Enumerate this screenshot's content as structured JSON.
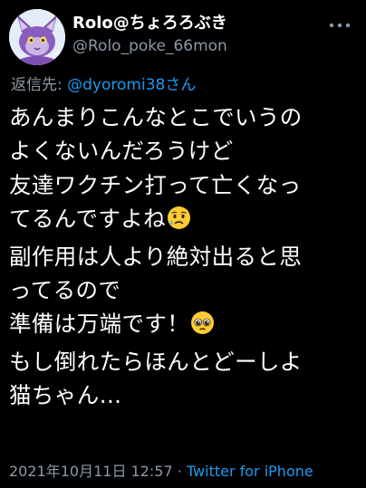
{
  "tweet": {
    "author": {
      "display_name": "Rolo@ちょろろぶき",
      "handle": "@Rolo_poke_66mon",
      "avatar_icon": "pokemon-avatar-icon"
    },
    "more_icon": "more-options-icon",
    "reply": {
      "prefix": "返信先: ",
      "mention": "@dyoromi38さん"
    },
    "lines": [
      "あんまりこんなとこでいうの",
      "よくないんだろうけど",
      "友達ワクチン打って亡くなっ",
      "てるんですよね",
      "副作用は人より絶対出ると思",
      "ってるので",
      "準備は万端です！",
      "もし倒れたらほんとどーしよ",
      "猫ちゃん…"
    ],
    "emojis": {
      "sad_face": "sad-relieved-face-emoji",
      "pleading_face": "pleading-face-emoji"
    },
    "meta": {
      "timestamp": "2021年10月11日 12:57",
      "separator": " · ",
      "source": "Twitter for iPhone"
    },
    "colors": {
      "background": "#000000",
      "text": "#ffffff",
      "secondary": "#8b98a5",
      "accent": "#1d9bf0"
    }
  }
}
